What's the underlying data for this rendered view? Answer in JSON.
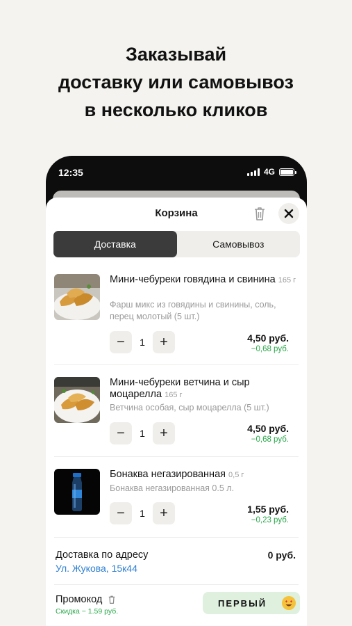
{
  "headline": {
    "line1": "Заказывай",
    "line2": "доставку или самовывоз",
    "line3": "в несколько кликов"
  },
  "status_bar": {
    "time": "12:35",
    "network": "4G"
  },
  "cart": {
    "title": "Корзина",
    "tabs": [
      {
        "label": "Доставка",
        "active": true
      },
      {
        "label": "Самовывоз",
        "active": false
      }
    ],
    "items": [
      {
        "name": "Мини-чебуреки говядина и свинина",
        "weight": "165 г",
        "description": "Фарш микс из говядины и свинины, соль, перец молотый (5 шт.)",
        "quantity": "1",
        "price": "4,50 руб.",
        "discount": "−0,68 руб."
      },
      {
        "name": "Мини-чебуреки ветчина и сыр моцарелла",
        "weight": "165 г",
        "description": "Ветчина особая, сыр моцарелла (5 шт.)",
        "quantity": "1",
        "price": "4,50 руб.",
        "discount": "−0,68 руб."
      },
      {
        "name": "Бонаква негазированная",
        "weight": "0,5 г",
        "description": "Бонаква негазированная 0.5 л.",
        "quantity": "1",
        "price": "1,55 руб.",
        "discount": "−0,23 руб."
      }
    ],
    "delivery": {
      "label": "Доставка по адресу",
      "address": "Ул. Жукова, 15к44",
      "price": "0 руб."
    },
    "promo": {
      "label": "Промокод",
      "discount_text": "Скидка − 1.59 руб.",
      "code": "ПЕРВЫЙ"
    }
  },
  "colors": {
    "background": "#f4f3ef",
    "active_tab": "#3b3b3b",
    "discount_green": "#2aa84a",
    "address_blue": "#2f7fd1",
    "promo_chip": "#dff0df"
  },
  "icons": [
    "trash-icon",
    "close-icon",
    "minus-icon",
    "plus-icon",
    "signal-icon",
    "battery-icon",
    "smiling-face-emoji-icon"
  ]
}
